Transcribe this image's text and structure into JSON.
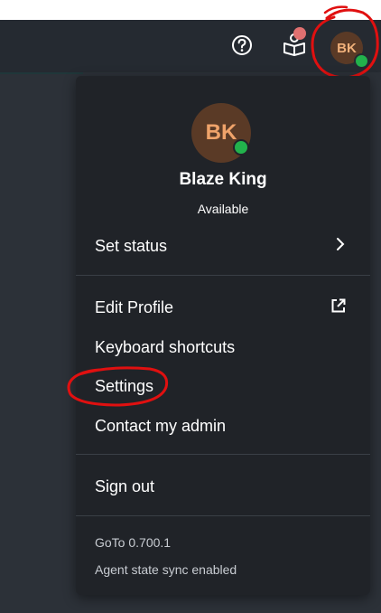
{
  "header": {
    "help_icon": "help-circle-icon",
    "learn_icon": "book-icon",
    "avatar_initials": "BK",
    "avatar_bg": "#5a3a26",
    "status_color": "#22b24c",
    "notification_color": "#e07070",
    "annotation_color": "#e01010"
  },
  "profile": {
    "initials": "BK",
    "name": "Blaze King",
    "status": "Available"
  },
  "menu": {
    "set_status": "Set status",
    "edit_profile": "Edit Profile",
    "keyboard_shortcuts": "Keyboard shortcuts",
    "settings": "Settings",
    "contact_admin": "Contact my admin",
    "sign_out": "Sign out"
  },
  "footer": {
    "version": "GoTo 0.700.1",
    "sync_status": "Agent state sync enabled"
  }
}
